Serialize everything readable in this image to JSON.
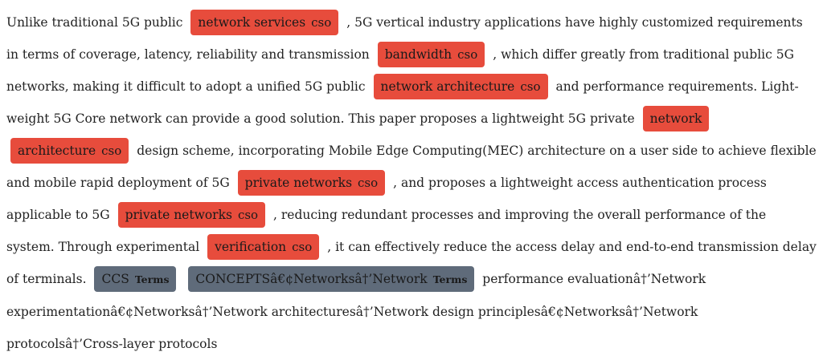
{
  "colors": {
    "cso_highlight": "#e74c3c",
    "terms_highlight": "#5f6b7a",
    "text": "#222222",
    "background": "#ffffff"
  },
  "paragraph": {
    "t1": "Unlike traditional 5G public",
    "tag1": {
      "text": "network services",
      "kind": "cso"
    },
    "t2": ", 5G vertical industry applications have highly customized requirements in terms of coverage, latency, reliability and transmission",
    "tag2": {
      "text": "bandwidth",
      "kind": "cso"
    },
    "t3": ", which differ greatly from traditional public 5G networks, making it difficult to adopt a unified 5G public",
    "tag3": {
      "text": "network architecture",
      "kind": "cso"
    },
    "t4": "and performance requirements. Light-weight 5G Core network can provide a good solution. This paper proposes a lightweight 5G private",
    "tag4": {
      "text": "network architecture",
      "kind": "cso"
    },
    "t5": "design scheme, incorporating Mobile Edge Computing(MEC) architecture on a user side to achieve flexible and mobile rapid deployment of 5G",
    "tag5": {
      "text": "private networks",
      "kind": "cso"
    },
    "t6": ", and proposes a lightweight access authentication process applicable to 5G",
    "tag6": {
      "text": "private networks",
      "kind": "cso"
    },
    "t7": ", reducing redundant processes and improving the overall performance of the system. Through experimental",
    "tag7": {
      "text": "verification",
      "kind": "cso"
    },
    "t8": ", it can effectively reduce the access delay and end-to-end transmission delay of terminals.",
    "tag8": {
      "text": "CCS",
      "kind": "Terms"
    },
    "tag9": {
      "text": "CONCEPTSâ€¢Networksâ†’Network",
      "kind": "Terms"
    },
    "t9": "performance evaluationâ†’Network experimentationâ€¢Networksâ†’Network architecturesâ†’Network design principlesâ€¢Networksâ†’Network protocolsâ†’Cross-layer protocols"
  }
}
